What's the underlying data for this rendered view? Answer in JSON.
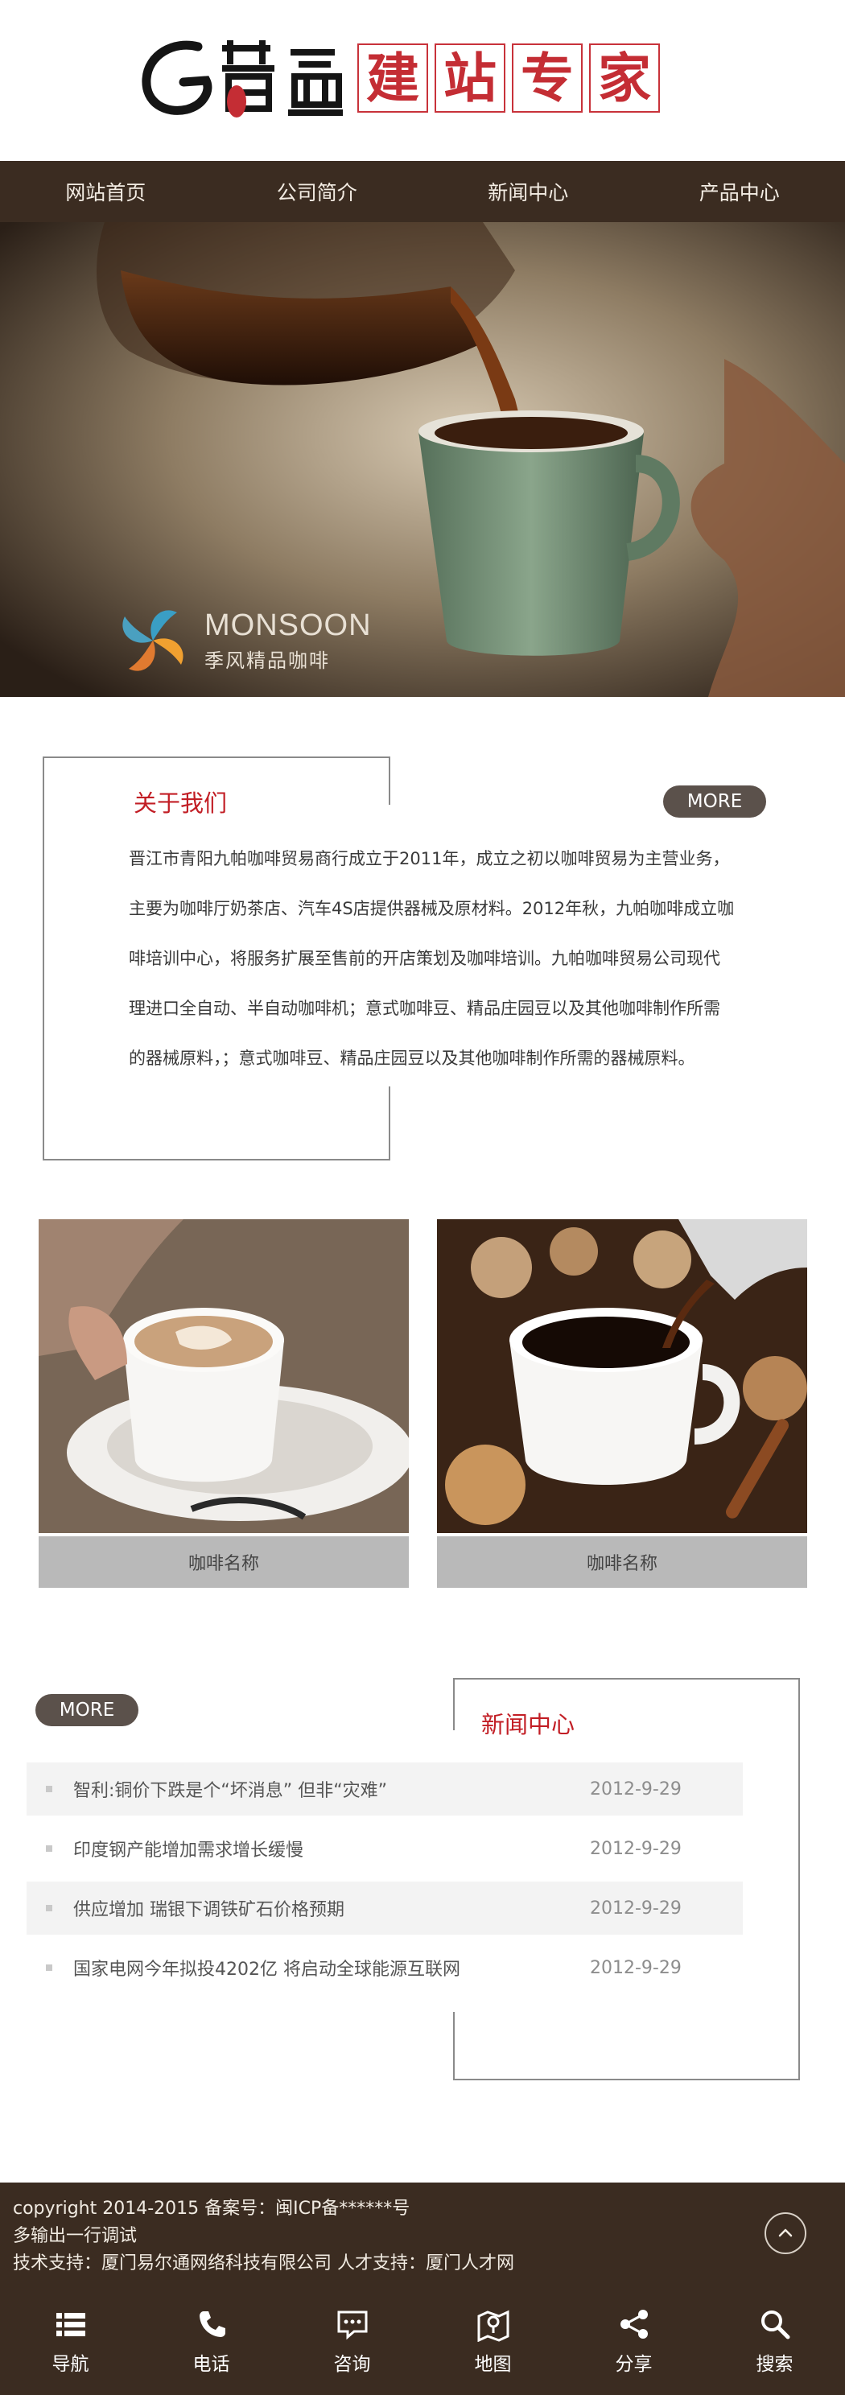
{
  "logo": {
    "tiles": [
      "建",
      "站",
      "专",
      "家"
    ]
  },
  "nav": {
    "items": [
      "网站首页",
      "公司简介",
      "新闻中心",
      "产品中心"
    ]
  },
  "banner": {
    "brand_name": "MONSOON",
    "brand_sub": "季风精品咖啡"
  },
  "about": {
    "title": "关于我们",
    "more": "MORE",
    "lines": [
      "晋江市青阳九帕咖啡贸易商行成立于2011年，成立之初以咖啡贸易为主营业务，",
      "主要为咖啡厅奶茶店、汽车4S店提供器械及原材料。2012年秋，九帕咖啡成立咖",
      "啡培训中心，将服务扩展至售前的开店策划及咖啡培训。九帕咖啡贸易公司现代",
      "理进口全自动、半自动咖啡机；意式咖啡豆、精品庄园豆以及其他咖啡制作所需",
      "的器械原料，；意式咖啡豆、精品庄园豆以及其他咖啡制作所需的器械原料。"
    ]
  },
  "products": [
    {
      "caption": "咖啡名称"
    },
    {
      "caption": "咖啡名称"
    }
  ],
  "news": {
    "title": "新闻中心",
    "more": "MORE",
    "items": [
      {
        "text": "智利:铜价下跌是个“坏消息” 但非“灾难”",
        "date": "2012-9-29"
      },
      {
        "text": "印度钢产能增加需求增长缓慢",
        "date": "2012-9-29"
      },
      {
        "text": "供应增加 瑞银下调铁矿石价格预期",
        "date": "2012-9-29"
      },
      {
        "text": "国家电网今年拟投4202亿 将启动全球能源互联网",
        "date": "2012-9-29"
      }
    ]
  },
  "footer": {
    "line1": "copyright 2014-2015 备案号：闽ICP备******号",
    "line2": "多输出一行调试",
    "line3": "技术支持：厦门易尔通网络科技有限公司 人才支持：厦门人才网"
  },
  "toolbar": {
    "items": [
      {
        "label": "导航",
        "icon": "list-icon"
      },
      {
        "label": "电话",
        "icon": "phone-icon"
      },
      {
        "label": "咨询",
        "icon": "chat-icon"
      },
      {
        "label": "地图",
        "icon": "map-icon"
      },
      {
        "label": "分享",
        "icon": "share-icon"
      },
      {
        "label": "搜索",
        "icon": "search-icon"
      }
    ]
  },
  "colors": {
    "brand_dark": "#3b2c21",
    "accent_red": "#c21e25",
    "more_button": "#5b514b"
  }
}
